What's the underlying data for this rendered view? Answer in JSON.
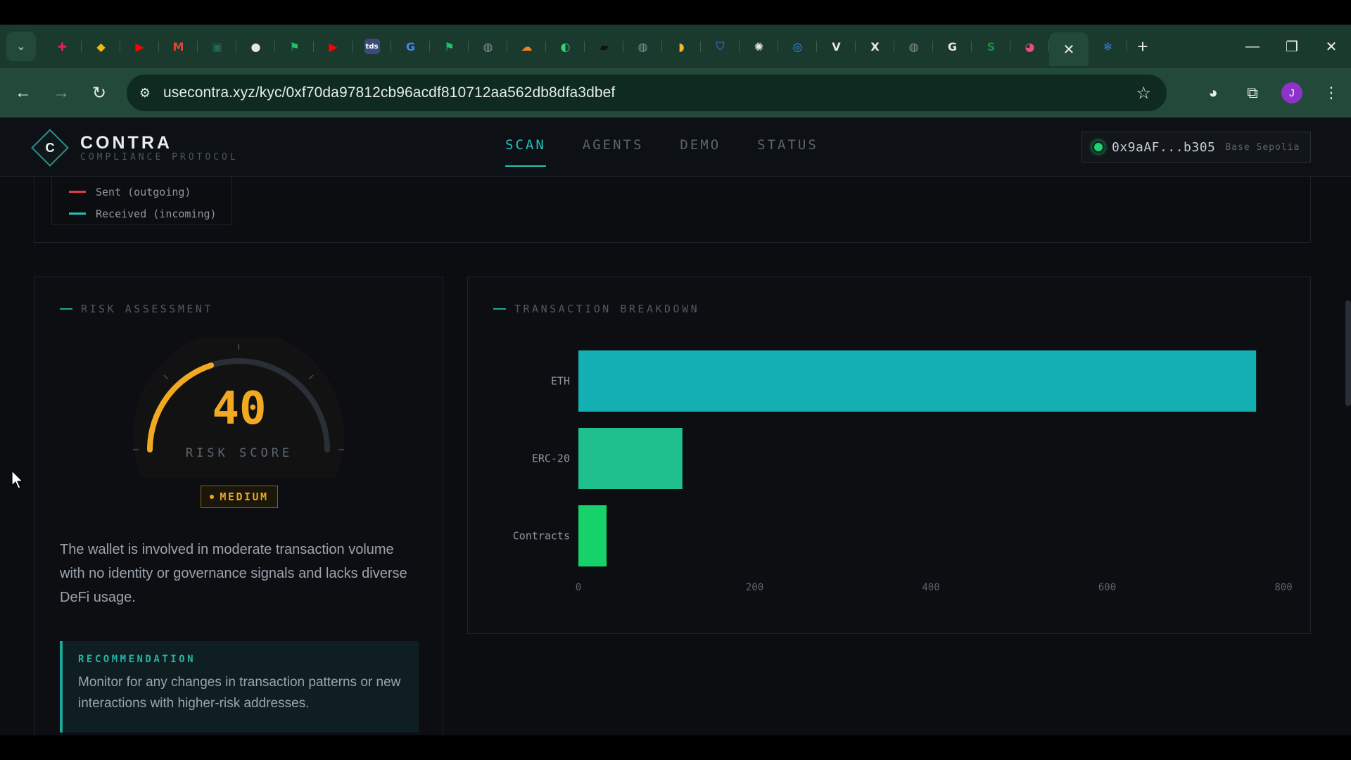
{
  "browser": {
    "tabs": [
      {
        "icon": "slack-icon",
        "color": "#e01e5a",
        "glyph": "✚"
      },
      {
        "icon": "binance-icon",
        "color": "#f0b90b",
        "glyph": "◆"
      },
      {
        "icon": "youtube-icon",
        "color": "#ff0000",
        "glyph": "▶"
      },
      {
        "icon": "gmail-icon",
        "color": "#ea4335",
        "glyph": "M"
      },
      {
        "icon": "app-icon",
        "color": "#1d6b5a",
        "glyph": "▣"
      },
      {
        "icon": "github-icon",
        "color": "#e6e6e6",
        "glyph": "●"
      },
      {
        "icon": "app-icon",
        "color": "#1fc16b",
        "glyph": "⚑"
      },
      {
        "icon": "youtube-icon",
        "color": "#ff0000",
        "glyph": "▶"
      },
      {
        "icon": "tds-icon",
        "color": "#3b4a7a",
        "glyph": "tds"
      },
      {
        "icon": "google-icon",
        "color": "#4285f4",
        "glyph": "G"
      },
      {
        "icon": "app-icon",
        "color": "#1fc16b",
        "glyph": "⚑"
      },
      {
        "icon": "globe-icon",
        "color": "#8a8f94",
        "glyph": "◍"
      },
      {
        "icon": "cloud-icon",
        "color": "#f6821f",
        "glyph": "☁"
      },
      {
        "icon": "app-icon",
        "color": "#36d27a",
        "glyph": "◐"
      },
      {
        "icon": "app-icon",
        "color": "#111111",
        "glyph": "▰"
      },
      {
        "icon": "globe-icon",
        "color": "#8a8f94",
        "glyph": "◍"
      },
      {
        "icon": "app-icon",
        "color": "#f7b52c",
        "glyph": "◗"
      },
      {
        "icon": "shield-icon",
        "color": "#2e5fa8",
        "glyph": "⛉"
      },
      {
        "icon": "openai-icon",
        "color": "#e6e6e6",
        "glyph": "✺"
      },
      {
        "icon": "app-icon",
        "color": "#3e8ef7",
        "glyph": "◎"
      },
      {
        "icon": "v-icon",
        "color": "#e6e6e6",
        "glyph": "V"
      },
      {
        "icon": "x-icon",
        "color": "#e6e6e6",
        "glyph": "X"
      },
      {
        "icon": "globe-icon",
        "color": "#8a8f94",
        "glyph": "◍"
      },
      {
        "icon": "grammarly-icon",
        "color": "#e6e6e6",
        "glyph": "G"
      },
      {
        "icon": "sheets-icon",
        "color": "#1e8e3e",
        "glyph": "S"
      },
      {
        "icon": "app-icon",
        "color": "#e8507a",
        "glyph": "◕"
      }
    ],
    "active_tab": {
      "icon": "close-icon",
      "glyph": "✕"
    },
    "after_active": {
      "icon": "app-icon",
      "color": "#2f7de1",
      "glyph": "❄"
    },
    "url": "usecontra.xyz/kyc/0xf70da97812cb96acdf810712aa562db8dfa3dbef",
    "profile_initial": "J"
  },
  "app": {
    "brand_name": "CONTRA",
    "brand_tagline": "COMPLIANCE PROTOCOL",
    "logo_letter": "C",
    "nav": [
      {
        "label": "SCAN",
        "active": true
      },
      {
        "label": "AGENTS",
        "active": false
      },
      {
        "label": "DEMO",
        "active": false
      },
      {
        "label": "STATUS",
        "active": false
      }
    ],
    "wallet": {
      "address": "0x9aAF...b305",
      "network": "Base Sepolia"
    }
  },
  "flow_legend": [
    {
      "label": "Sent (outgoing)",
      "color": "#e23b4a"
    },
    {
      "label": "Received (incoming)",
      "color": "#22c4b8"
    }
  ],
  "risk": {
    "title": "RISK ASSESSMENT",
    "score": "40",
    "score_value": 40,
    "score_max": 100,
    "score_label": "RISK SCORE",
    "level": "MEDIUM",
    "accent": "#f2a922",
    "summary": "The wallet is involved in moderate transaction volume with no identity or governance signals and lacks diverse DeFi usage.",
    "recommendation_title": "RECOMMENDATION",
    "recommendation": "Monitor for any changes in transaction patterns or new interactions with higher-risk addresses."
  },
  "breakdown": {
    "title": "TRANSACTION BREAKDOWN"
  },
  "chart_data": {
    "type": "bar",
    "orientation": "horizontal",
    "title": "",
    "categories": [
      "ETH",
      "ERC-20",
      "Contracts"
    ],
    "values": [
      769,
      118,
      32
    ],
    "colors": [
      "#14b0b4",
      "#20c08c",
      "#17d16a"
    ],
    "xlim": [
      0,
      800
    ],
    "xticks": [
      "0",
      "200",
      "400",
      "600",
      "800"
    ],
    "grid": false,
    "legend": "none"
  }
}
